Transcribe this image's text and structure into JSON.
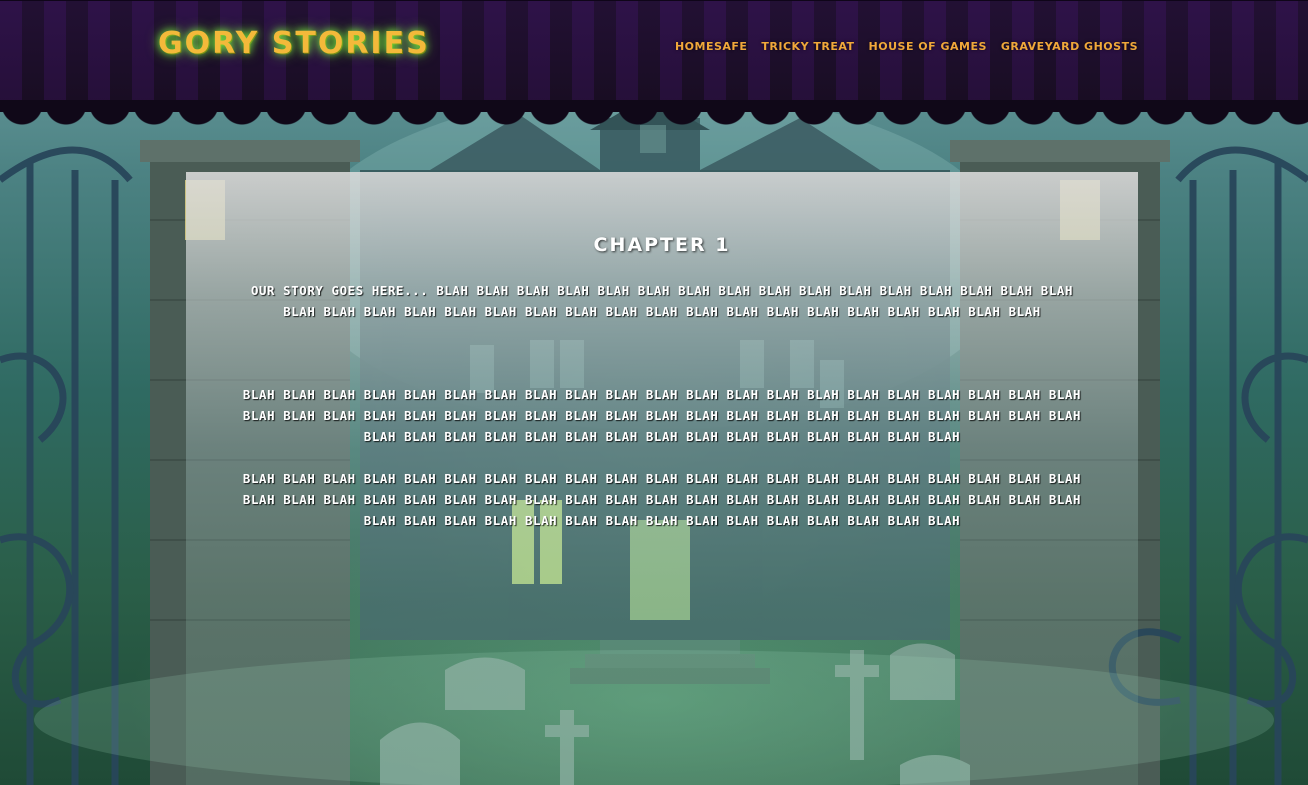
{
  "header": {
    "logo": "GORY STORIES",
    "nav": [
      "HOMESAFE",
      "TRICKY TREAT",
      "HOUSE OF GAMES",
      "GRAVEYARD GHOSTS"
    ]
  },
  "main": {
    "chapter_title": "CHAPTER 1",
    "paragraphs": [
      "OUR STORY GOES HERE... BLAH BLAH BLAH BLAH BLAH BLAH BLAH BLAH BLAH BLAH BLAH BLAH BLAH BLAH BLAH BLAH BLAH BLAH BLAH BLAH BLAH BLAH BLAH BLAH BLAH BLAH BLAH BLAH BLAH BLAH BLAH BLAH BLAH BLAH BLAH",
      "BLAH BLAH BLAH BLAH BLAH BLAH BLAH BLAH BLAH BLAH BLAH BLAH BLAH BLAH BLAH BLAH BLAH BLAH BLAH BLAH BLAH BLAH BLAH BLAH BLAH BLAH BLAH BLAH BLAH BLAH BLAH BLAH BLAH BLAH BLAH BLAH BLAH BLAH BLAH BLAH BLAH BLAH BLAH BLAH BLAH BLAH BLAH BLAH BLAH BLAH BLAH BLAH BLAH BLAH BLAH BLAH BLAH",
      "BLAH BLAH BLAH BLAH BLAH BLAH BLAH BLAH BLAH BLAH BLAH BLAH BLAH BLAH BLAH BLAH BLAH BLAH BLAH BLAH BLAH BLAH BLAH BLAH BLAH BLAH BLAH BLAH BLAH BLAH BLAH BLAH BLAH BLAH BLAH BLAH BLAH BLAH BLAH BLAH BLAH BLAH BLAH BLAH BLAH BLAH BLAH BLAH BLAH BLAH BLAH BLAH BLAH BLAH BLAH BLAH BLAH"
    ]
  },
  "colors": {
    "logo": "#f3b93a",
    "logo_glow": "#82ff46",
    "nav": "#f0a83a",
    "stripe_purple": "#2a1240",
    "stripe_dark": "#1a0f24"
  }
}
